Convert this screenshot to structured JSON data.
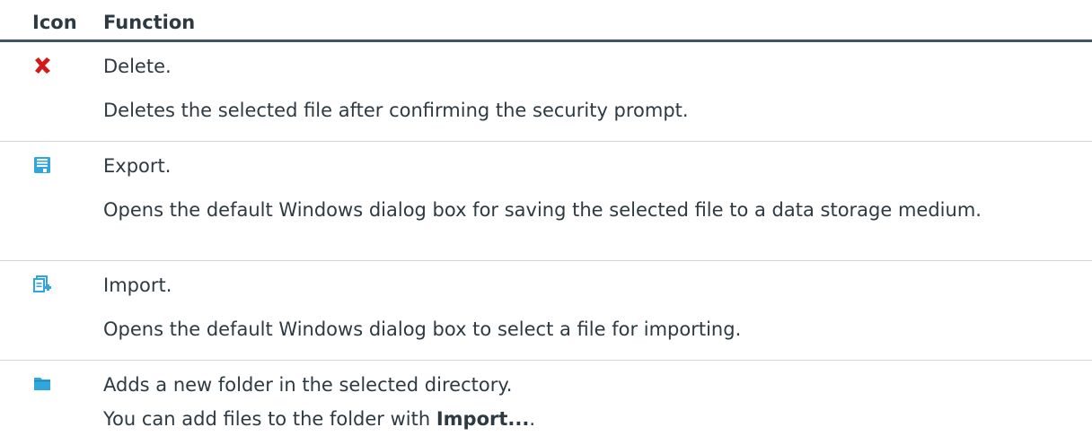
{
  "header": {
    "icon_col": "Icon",
    "function_col": "Function"
  },
  "rows": [
    {
      "icon": "delete-icon",
      "title": "Delete.",
      "desc": "Deletes the selected file after confirming the security prompt."
    },
    {
      "icon": "save-icon",
      "title": "Export.",
      "desc": "Opens the default Windows dialog box for saving the selected file to a data storage medium."
    },
    {
      "icon": "import-icon",
      "title": "Import.",
      "desc": "Opens the default Windows dialog box to select a file for importing."
    },
    {
      "icon": "folder-icon",
      "title": "Adds a new folder in the selected directory.",
      "desc_prefix": "You can add files to the folder with ",
      "desc_bold": "Import...",
      "desc_suffix": "."
    }
  ],
  "colors": {
    "delete": "#d11a1a",
    "accent": "#2fa7dd",
    "header_rule": "#3f5663"
  }
}
